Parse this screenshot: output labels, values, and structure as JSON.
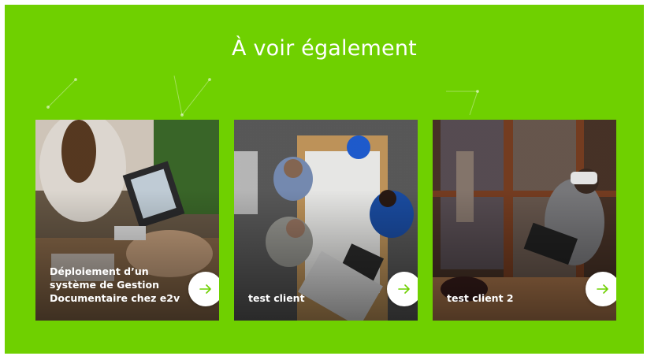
{
  "section": {
    "title": "À voir également"
  },
  "cards": [
    {
      "label": "Déploiement d’un système de Gestion Documentaire chez e2v"
    },
    {
      "label": "test client"
    },
    {
      "label": "test client 2"
    }
  ],
  "colors": {
    "accent": "#6fd000",
    "arrow": "#6fd000",
    "text": "#ffffff"
  },
  "icons": {
    "arrow": "arrow-right-icon"
  }
}
